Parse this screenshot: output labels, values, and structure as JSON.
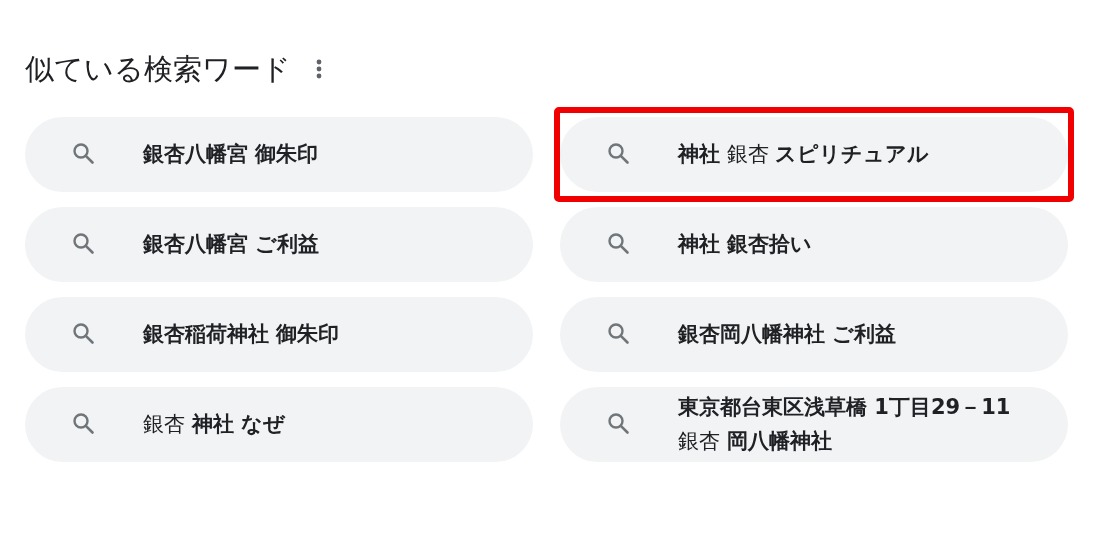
{
  "section": {
    "title": "似ている検索ワード"
  },
  "suggestions": [
    {
      "text": "銀杏八幡宮 御朱印",
      "bold": true,
      "highlighted": false
    },
    {
      "text": "銀杏八幡宮 ご利益",
      "bold": true,
      "highlighted": false
    },
    {
      "text": "銀杏稲荷神社 御朱印",
      "bold": true,
      "highlighted": false
    },
    {
      "text": "銀杏 **神社 なぜ**",
      "bold": false,
      "highlighted": false
    },
    {
      "text": "**神社** 銀杏 **スピリチュアル**",
      "bold": false,
      "highlighted": true
    },
    {
      "text": "神社 銀杏拾い",
      "bold": true,
      "highlighted": false
    },
    {
      "text": "銀杏岡八幡神社 ご利益",
      "bold": true,
      "highlighted": false
    },
    {
      "text": "**東京都台東区浅草橋 1丁目29－11** 銀杏 **岡八幡神社**",
      "bold": false,
      "highlighted": false
    }
  ]
}
